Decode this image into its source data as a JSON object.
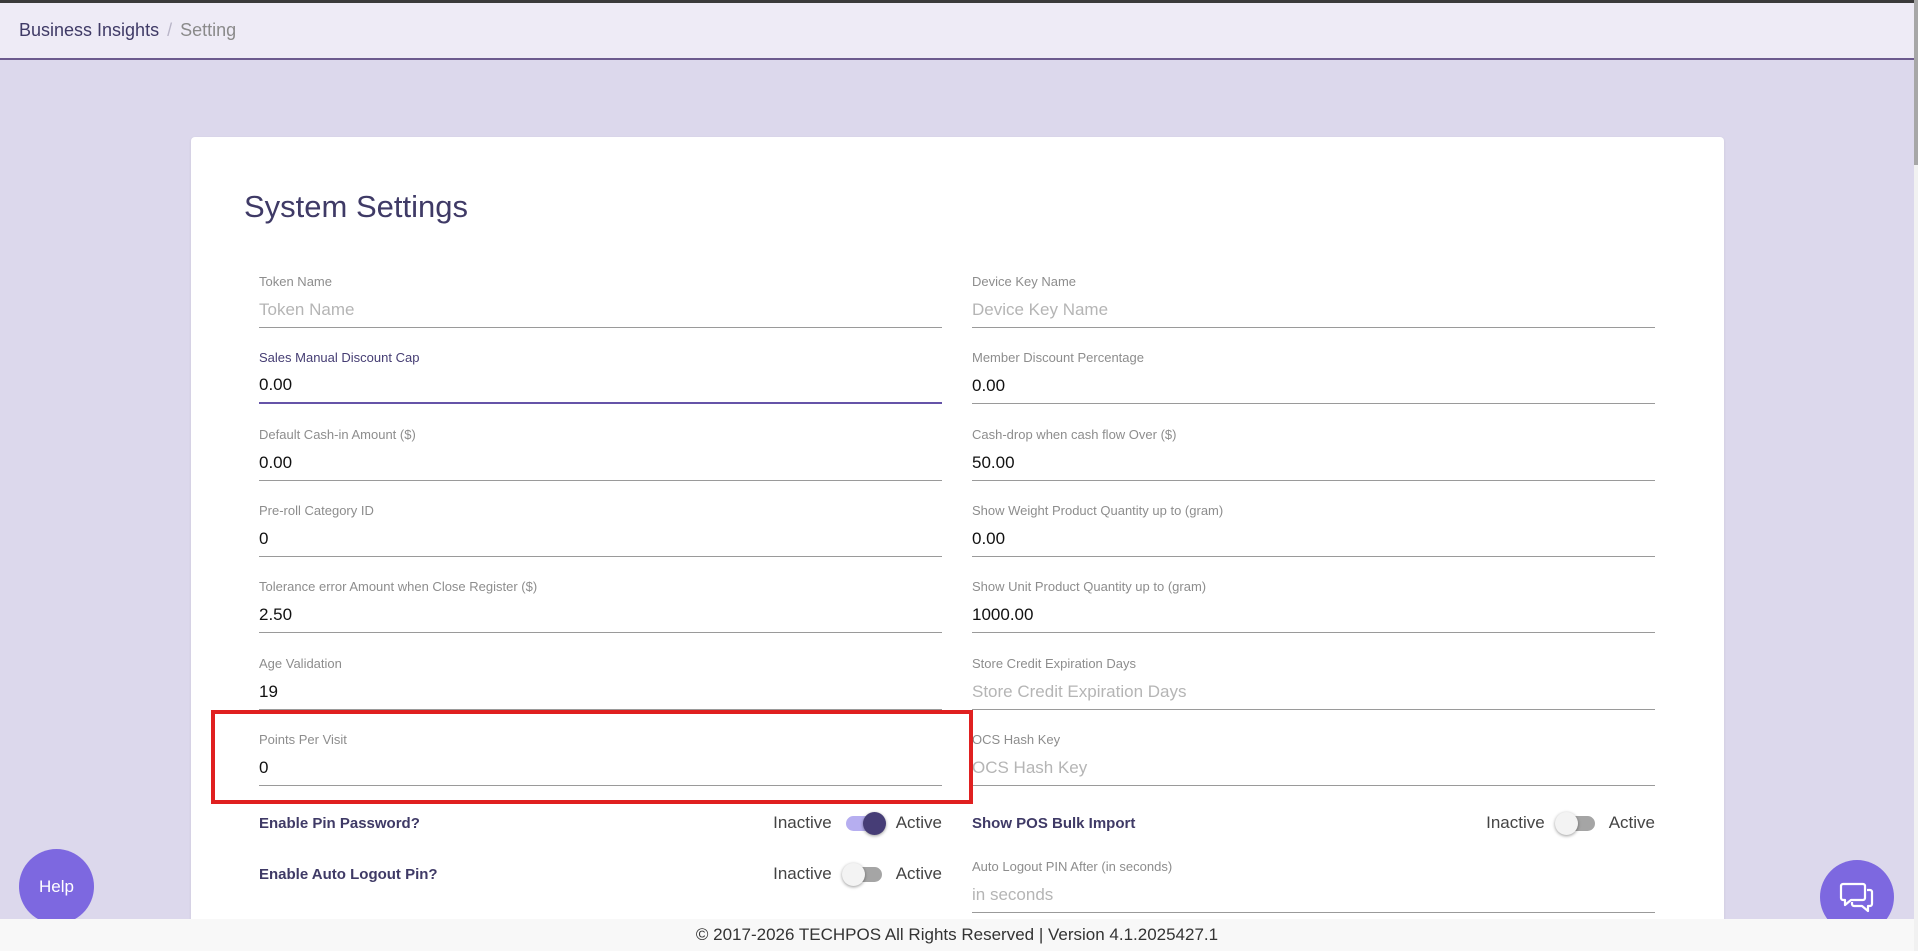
{
  "breadcrumb": {
    "home": "Business Insights",
    "separator": "/",
    "current": "Setting"
  },
  "page_title": "System Settings",
  "fields": {
    "token_name": {
      "label": "Token Name",
      "value": "",
      "placeholder": "Token Name"
    },
    "device_key_name": {
      "label": "Device Key Name",
      "value": "",
      "placeholder": "Device Key Name"
    },
    "sales_manual_discount_cap": {
      "label": "Sales Manual Discount Cap",
      "value": "0.00",
      "placeholder": ""
    },
    "member_discount_percentage": {
      "label": "Member Discount Percentage",
      "value": "0.00",
      "placeholder": ""
    },
    "default_cash_in_amount": {
      "label": "Default Cash-in Amount ($)",
      "value": "0.00",
      "placeholder": ""
    },
    "cash_drop_over": {
      "label": "Cash-drop when cash flow Over ($)",
      "value": "50.00",
      "placeholder": ""
    },
    "pre_roll_category_id": {
      "label": "Pre-roll Category ID",
      "value": "0",
      "placeholder": ""
    },
    "show_weight_product_qty": {
      "label": "Show Weight Product Quantity up to (gram)",
      "value": "0.00",
      "placeholder": ""
    },
    "tolerance_error_amount": {
      "label": "Tolerance error Amount when Close Register ($)",
      "value": "2.50",
      "placeholder": ""
    },
    "show_unit_product_qty": {
      "label": "Show Unit Product Quantity up to (gram)",
      "value": "1000.00",
      "placeholder": ""
    },
    "age_validation": {
      "label": "Age Validation",
      "value": "19",
      "placeholder": ""
    },
    "store_credit_expiration_days": {
      "label": "Store Credit Expiration Days",
      "value": "",
      "placeholder": "Store Credit Expiration Days"
    },
    "points_per_visit": {
      "label": "Points Per Visit",
      "value": "0",
      "placeholder": ""
    },
    "ocs_hash_key": {
      "label": "OCS Hash Key",
      "value": "",
      "placeholder": "OCS Hash Key"
    },
    "auto_logout_pin_after": {
      "label": "Auto Logout PIN After (in seconds)",
      "value": "",
      "placeholder": "in seconds"
    }
  },
  "toggles": {
    "enable_pin_password": {
      "label": "Enable Pin Password?",
      "inactive": "Inactive",
      "active": "Active",
      "state": "on"
    },
    "show_pos_bulk_import": {
      "label": "Show POS Bulk Import",
      "inactive": "Inactive",
      "active": "Active",
      "state": "off"
    },
    "enable_auto_logout_pin": {
      "label": "Enable Auto Logout Pin?",
      "inactive": "Inactive",
      "active": "Active",
      "state": "off"
    }
  },
  "help_label": "Help",
  "chat_icon": "chat-bubbles-icon",
  "footer": "© 2017-2026 TECHPOS All Rights Reserved | Version 4.1.2025427.1",
  "colors": {
    "accent": "#7d68e0",
    "title": "#3f3a66",
    "highlight": "#e02020",
    "background": "#dcd8ec"
  }
}
